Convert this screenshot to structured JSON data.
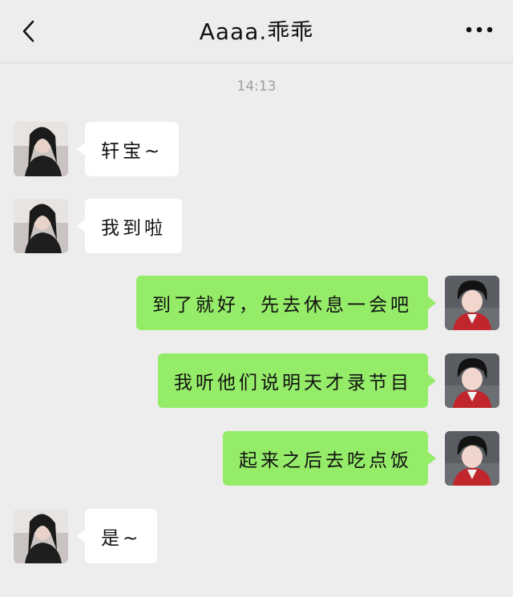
{
  "header": {
    "title": "Aaaa.乖乖",
    "back_icon": "chevron-left-icon",
    "more_icon": "more-dots-icon"
  },
  "timestamp": "14:13",
  "messages": [
    {
      "side": "in",
      "text": "轩宝~"
    },
    {
      "side": "in",
      "text": "我到啦"
    },
    {
      "side": "out",
      "text": "到了就好，先去休息一会吧"
    },
    {
      "side": "out",
      "text": "我听他们说明天才录节目"
    },
    {
      "side": "out",
      "text": "起来之后去吃点饭"
    },
    {
      "side": "in",
      "text": "是~"
    }
  ],
  "colors": {
    "background": "#ededed",
    "incoming_bubble": "#ffffff",
    "outgoing_bubble": "#95ec69"
  }
}
